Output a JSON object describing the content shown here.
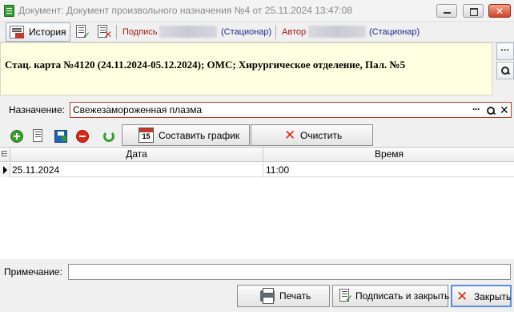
{
  "window": {
    "title": "Документ: Документ произвольного назначения №4 от 25.11.2024 13:47:08",
    "close_glyph": "✕"
  },
  "toolbar": {
    "history_label": "История",
    "sign_label": "Подпись",
    "sign_department": "(Стационар)",
    "author_label": "Автор",
    "author_department": "(Стационар)"
  },
  "header": {
    "info": "Стац. карта №4120 (24.11.2024-05.12.2024); ОМС; Хирургическое отделение, Пал. №5",
    "more_glyph": "···"
  },
  "assignment": {
    "label": "Назначение:",
    "value": "Свежезамороженная плазма",
    "dots_glyph": "···",
    "clear_glyph": "✕"
  },
  "grid_toolbar": {
    "schedule_label": "Составить график",
    "schedule_icon_day": "15",
    "clear_label": "Очистить",
    "clear_glyph": "✕"
  },
  "grid": {
    "columns": [
      "Дата",
      "Время"
    ],
    "rows": [
      {
        "date": "25.11.2024",
        "time": "11:00"
      }
    ]
  },
  "footer": {
    "note_label": "Примечание:",
    "note_value": "",
    "print_label": "Печать",
    "sign_close_label": "Подписать и закрыть",
    "close_label": "Закрыть",
    "close_glyph": "✕"
  },
  "colors": {
    "info_background": "#ffffe1",
    "required_border": "#c0392b",
    "label_red": "#a31515",
    "label_blue": "#1a2b8c"
  }
}
